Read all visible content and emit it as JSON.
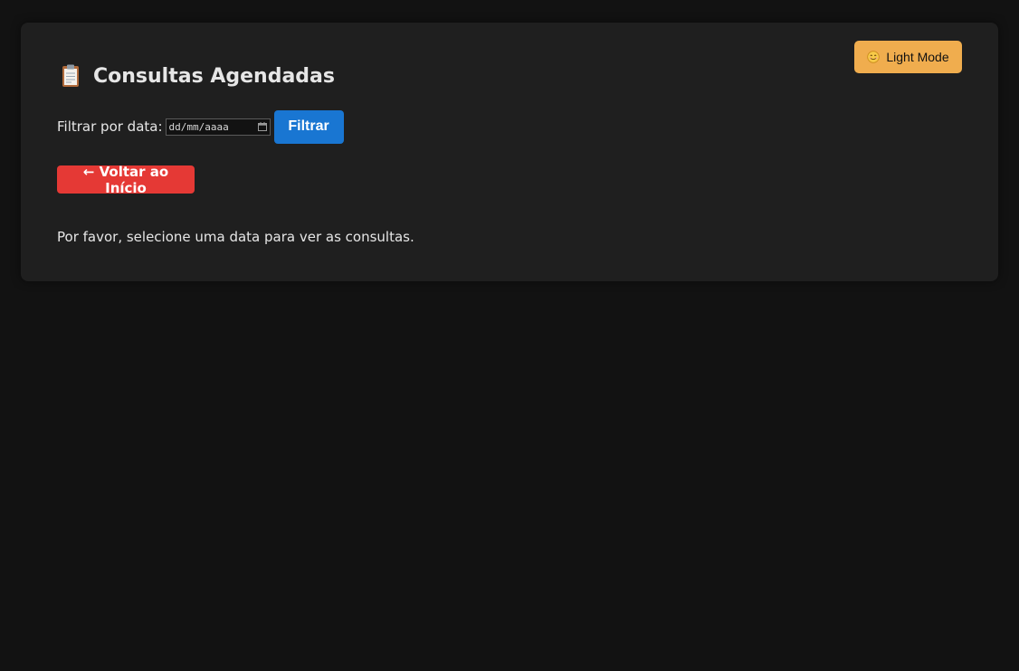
{
  "theme_toggle": {
    "label": "Light Mode",
    "icon": "smiling-face-icon"
  },
  "header": {
    "icon": "clipboard-icon",
    "title": "Consultas Agendadas"
  },
  "filter": {
    "label": "Filtrar por data:",
    "date_placeholder": "dd/mm/aaaa",
    "button_label": "Filtrar"
  },
  "back_button": {
    "label": "← Voltar ao Início"
  },
  "message": {
    "text": "Por favor, selecione uma data para ver as consultas."
  },
  "colors": {
    "background": "#121212",
    "card": "#1f1f1f",
    "theme_toggle": "#f0ad4e",
    "filter_button": "#1976d2",
    "back_button": "#e53935"
  }
}
